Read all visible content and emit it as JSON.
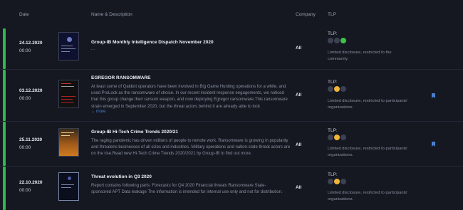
{
  "header": {
    "date": "Date",
    "name": "Name & Description",
    "company": "Company",
    "tlp": "TLP"
  },
  "colors": {
    "accent_green": "#2fb84a",
    "tlp_green": "#3ec24a",
    "tlp_amber": "#f0b43a",
    "tlp_off": "#3c4152",
    "link_blue": "#4a7fd1"
  },
  "rows": [
    {
      "date": "24.12.2020",
      "time": "00:00",
      "thumbnail": "report-cover-icon",
      "title": "Group-IB Monthly Intelligence Dispatch November 2020",
      "description": "...",
      "more_label": "",
      "company": "All",
      "tlp_label": "TLP:",
      "tlp_level": "green",
      "tlp_text": "Limited disclosure, restricted to the community.",
      "bookmarked": false
    },
    {
      "date": "03.12.2020",
      "time": "00:00",
      "thumbnail": "report-cover-icon",
      "title": "EGREGOR RANSOMWARE",
      "description": "At least some of Qakbot operators have been involved in Big Game Hunting operations for a while, and used ProLock as the ransomware of choice. In our recent incident response engagements, we noticed that this group change their ransom weapon, and now deploying Egregor ransomware.This ransomware strain emerged in September 2020, but the threat actors behind it are already able to lock",
      "more_label": "more",
      "company": "All",
      "tlp_label": "TLP:",
      "tlp_level": "amber",
      "tlp_text": "Limited disclosure, restricted to participants' organizations.",
      "bookmarked": true
    },
    {
      "date": "25.11.2020",
      "time": "00:00",
      "thumbnail": "report-cover-icon",
      "title": "Group-IB Hi-Tech Crime Trends 2020/21",
      "description": "The raging pandemic has driven millions of people to remote work. Ransomware is growing in popularity and threatens businesses of all sizes and industries. Military operations and nation-state threat actors are on the rise.Read new Hi-Tech Crime Trends 2020/2021 by Group-IB to find out more.",
      "more_label": "",
      "company": "All",
      "tlp_label": "TLP:",
      "tlp_level": "amber",
      "tlp_text": "Limited disclosure, restricted to participants' organizations.",
      "bookmarked": true
    },
    {
      "date": "22.10.2020",
      "time": "00:00",
      "thumbnail": "report-cover-icon",
      "title": "Threat evolution in Q3 2020",
      "description": "Report contains following parts:   Forecasts for Q4 2020   Financial threats   Ransomware   State-sponsored APT   Data leakage The information is intended for internal use only and not for distribution.",
      "more_label": "",
      "company": "All",
      "tlp_label": "TLP:",
      "tlp_level": "amber",
      "tlp_text": "Limited disclosure, restricted to participants' organizations.",
      "bookmarked": false
    }
  ]
}
